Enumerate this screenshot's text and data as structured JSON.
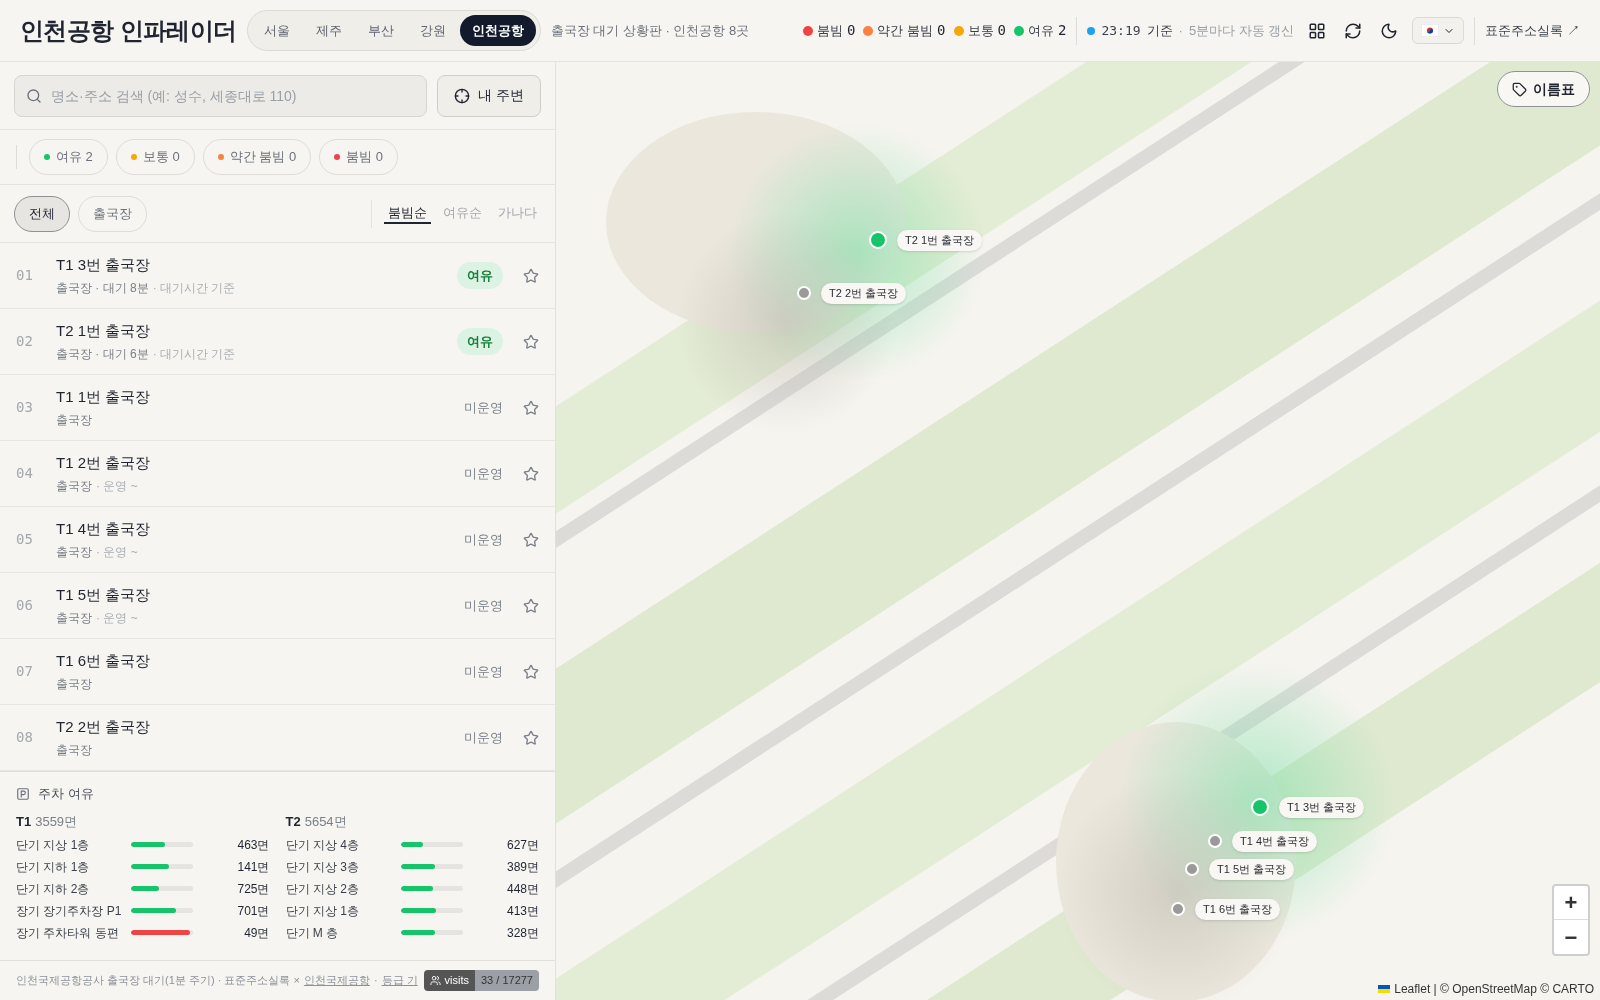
{
  "header": {
    "title": "인천공항 인파레이더",
    "cities": [
      {
        "label": "서울",
        "selected": false
      },
      {
        "label": "제주",
        "selected": false
      },
      {
        "label": "부산",
        "selected": false
      },
      {
        "label": "강원",
        "selected": false
      },
      {
        "label": "인천공항",
        "selected": true
      }
    ],
    "subtitle": "출국장 대기 상황판 · 인천공항 8곳",
    "legend": [
      {
        "label": "붐빔",
        "count": "0",
        "color": "#ef4444"
      },
      {
        "label": "약간 붐빔",
        "count": "0",
        "color": "#fb8140"
      },
      {
        "label": "보통",
        "count": "0",
        "color": "#f5a70b"
      },
      {
        "label": "여유",
        "count": "2",
        "color": "#16c46a"
      }
    ],
    "time": "23:19",
    "time_suffix": "기준",
    "separator": "·",
    "refresh_note": "5분마다 자동 갱신",
    "link": "표준주소실록 ↗"
  },
  "search": {
    "placeholder": "명소·주소 검색 (예: 성수, 세종대로 110)",
    "nearby_button": "내 주변"
  },
  "filters": [
    {
      "label": "여유 2",
      "color": "#16c46a"
    },
    {
      "label": "보통 0",
      "color": "#f5a70b"
    },
    {
      "label": "약간 붐빔 0",
      "color": "#fb8140"
    },
    {
      "label": "붐빔 0",
      "color": "#ef4444"
    }
  ],
  "type_tabs": [
    {
      "label": "전체",
      "selected": true
    },
    {
      "label": "출국장",
      "selected": false
    }
  ],
  "sort_tabs": [
    {
      "label": "붐빔순",
      "selected": true
    },
    {
      "label": "여유순",
      "selected": false
    },
    {
      "label": "가나다",
      "selected": false
    }
  ],
  "rows": [
    {
      "num": "01",
      "name": "T1 3번 출국장",
      "sub": "출국장 · 대기 8분",
      "note": "· 대기시간 기준",
      "status": "여유",
      "kind": "badge"
    },
    {
      "num": "02",
      "name": "T2 1번 출국장",
      "sub": "출국장 · 대기 6분",
      "note": "· 대기시간 기준",
      "status": "여유",
      "kind": "badge"
    },
    {
      "num": "03",
      "name": "T1 1번 출국장",
      "sub": "출국장",
      "status": "미운영",
      "kind": "plain"
    },
    {
      "num": "04",
      "name": "T1 2번 출국장",
      "sub": "출국장",
      "note": "· 운영 ~",
      "status": "미운영",
      "kind": "plain"
    },
    {
      "num": "05",
      "name": "T1 4번 출국장",
      "sub": "출국장",
      "note": "· 운영 ~",
      "status": "미운영",
      "kind": "plain"
    },
    {
      "num": "06",
      "name": "T1 5번 출국장",
      "sub": "출국장",
      "note": "· 운영 ~",
      "status": "미운영",
      "kind": "plain"
    },
    {
      "num": "07",
      "name": "T1 6번 출국장",
      "sub": "출국장",
      "status": "미운영",
      "kind": "plain"
    },
    {
      "num": "08",
      "name": "T2 2번 출국장",
      "sub": "출국장",
      "status": "미운영",
      "kind": "plain"
    }
  ],
  "parking": {
    "title": "주차 여유",
    "groups": [
      {
        "terminal": "T1",
        "total": "3559면",
        "lots": [
          {
            "name": "단기 지상 1층",
            "level": 0.55,
            "color": "#16c46a",
            "spaces": "463면"
          },
          {
            "name": "단기 지하 1층",
            "level": 0.61,
            "color": "#16c46a",
            "spaces": "141면"
          },
          {
            "name": "단기 지하 2층",
            "level": 0.45,
            "color": "#16c46a",
            "spaces": "725면"
          },
          {
            "name": "장기 장기주차장 P1",
            "level": 0.73,
            "color": "#16c46a",
            "spaces": "701면"
          },
          {
            "name": "장기 주차타워 동편",
            "level": 0.95,
            "color": "#ef4444",
            "spaces": "49면"
          }
        ]
      },
      {
        "terminal": "T2",
        "total": "5654면",
        "lots": [
          {
            "name": "단기 지상 4층",
            "level": 0.36,
            "color": "#16c46a",
            "spaces": "627면"
          },
          {
            "name": "단기 지상 3층",
            "level": 0.56,
            "color": "#16c46a",
            "spaces": "389면"
          },
          {
            "name": "단기 지상 2층",
            "level": 0.52,
            "color": "#16c46a",
            "spaces": "448면"
          },
          {
            "name": "단기 지상 1층",
            "level": 0.58,
            "color": "#16c46a",
            "spaces": "413면"
          },
          {
            "name": "단기 M 층",
            "level": 0.56,
            "color": "#16c46a",
            "spaces": "328면"
          }
        ]
      }
    ]
  },
  "footer": {
    "text": "인천국제공항공사 출국장 대기(1분 주기) · 표준주소실록 ×",
    "link": "인천국제공항",
    "separator": "·",
    "link2": "등급 기",
    "visits_label": "visits",
    "visits": "33 / 17277"
  },
  "map": {
    "label_button": "이름표",
    "zoom_in": "+",
    "zoom_out": "−",
    "attribution": "Leaflet | © OpenStreetMap © CARTO",
    "markers": [
      {
        "label": "T2 1번 출국장",
        "color": "#16c46a"
      },
      {
        "label": "T2 2번 출국장",
        "color": "#9a9a98"
      },
      {
        "label": "T1 3번 출국장",
        "color": "#16c46a"
      },
      {
        "label": "T1 4번 출국장",
        "color": "#9a9a98"
      },
      {
        "label": "T1 5번 출국장",
        "color": "#9a9a98"
      },
      {
        "label": "T1 6번 출국장",
        "color": "#9a9a98"
      }
    ]
  }
}
